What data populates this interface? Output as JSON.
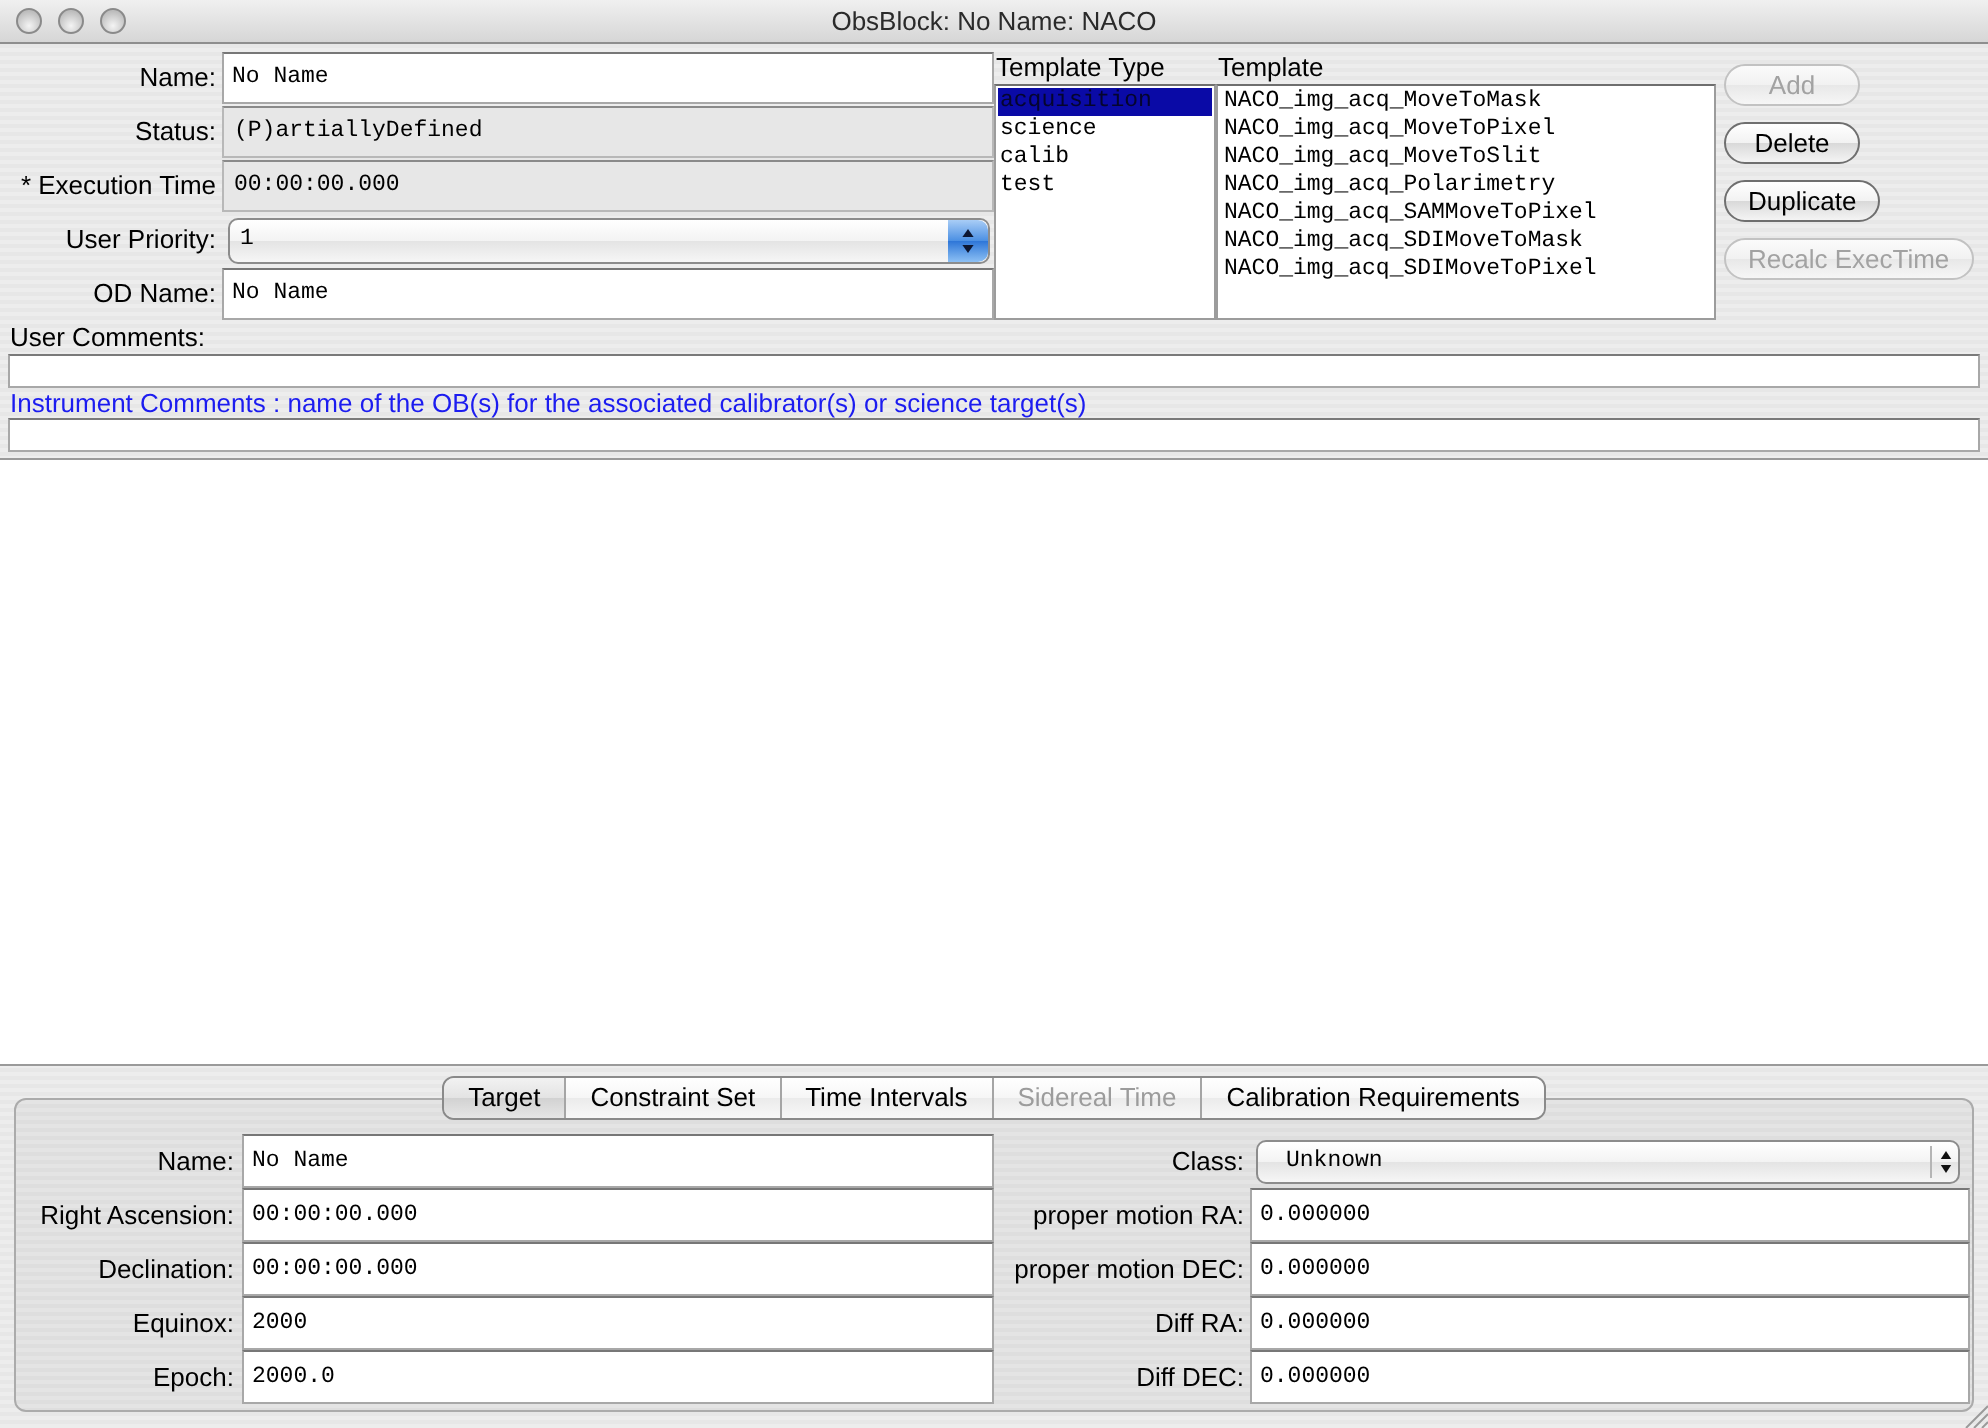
{
  "window": {
    "title": "ObsBlock: No Name: NACO"
  },
  "ob_form": [
    {
      "label": "Name:",
      "kind": "input",
      "value": "No Name"
    },
    {
      "label": "Status:",
      "kind": "readonly",
      "value": "(P)artiallyDefined"
    },
    {
      "label": "* Execution Time",
      "kind": "readonly",
      "value": "00:00:00.000"
    },
    {
      "label": "User Priority:",
      "kind": "select",
      "value": "1"
    },
    {
      "label": "OD Name:",
      "kind": "input",
      "value": "No Name"
    }
  ],
  "template_type": {
    "label": "Template Type",
    "items": [
      {
        "label": "acquisition",
        "selected": true
      },
      {
        "label": "science",
        "selected": false
      },
      {
        "label": "calib",
        "selected": false
      },
      {
        "label": "test",
        "selected": false
      }
    ]
  },
  "template": {
    "label": "Template",
    "items": [
      {
        "label": "NACO_img_acq_MoveToMask",
        "selected": false
      },
      {
        "label": "NACO_img_acq_MoveToPixel",
        "selected": false
      },
      {
        "label": "NACO_img_acq_MoveToSlit",
        "selected": false
      },
      {
        "label": "NACO_img_acq_Polarimetry",
        "selected": false
      },
      {
        "label": "NACO_img_acq_SAMMoveToPixel",
        "selected": false
      },
      {
        "label": "NACO_img_acq_SDIMoveToMask",
        "selected": false
      },
      {
        "label": "NACO_img_acq_SDIMoveToPixel",
        "selected": false
      }
    ]
  },
  "buttons": [
    {
      "label": "Add",
      "disabled": true
    },
    {
      "label": "Delete",
      "disabled": false
    },
    {
      "label": "Duplicate",
      "disabled": false
    },
    {
      "label": "Recalc ExecTime",
      "disabled": true
    }
  ],
  "user_comments": {
    "label": "User Comments:"
  },
  "instrument_comments": {
    "label": "Instrument Comments : name of the OB(s) for the associated calibrator(s) or science target(s)"
  },
  "tabs": [
    {
      "label": "Target",
      "selected": true,
      "disabled": false
    },
    {
      "label": "Constraint Set",
      "selected": false,
      "disabled": false
    },
    {
      "label": "Time Intervals",
      "selected": false,
      "disabled": false
    },
    {
      "label": "Sidereal Time",
      "selected": false,
      "disabled": true
    },
    {
      "label": "Calibration Requirements",
      "selected": false,
      "disabled": false
    }
  ],
  "target_form": {
    "left": [
      {
        "label": "Name:",
        "kind": "input",
        "value": "No Name"
      },
      {
        "label": "Right Ascension:",
        "kind": "input",
        "value": "00:00:00.000"
      },
      {
        "label": "Declination:",
        "kind": "input",
        "value": "00:00:00.000"
      },
      {
        "label": "Equinox:",
        "kind": "input",
        "value": "2000"
      },
      {
        "label": "Epoch:",
        "kind": "input",
        "value": "2000.0"
      }
    ],
    "right": [
      {
        "label": "Class:",
        "kind": "select",
        "value": "Unknown"
      },
      {
        "label": "proper motion RA:",
        "kind": "input",
        "value": "0.000000"
      },
      {
        "label": "proper motion DEC:",
        "kind": "input",
        "value": "0.000000"
      },
      {
        "label": "Diff RA:",
        "kind": "input",
        "value": "0.000000"
      },
      {
        "label": "Diff DEC:",
        "kind": "input",
        "value": "0.000000"
      }
    ]
  }
}
